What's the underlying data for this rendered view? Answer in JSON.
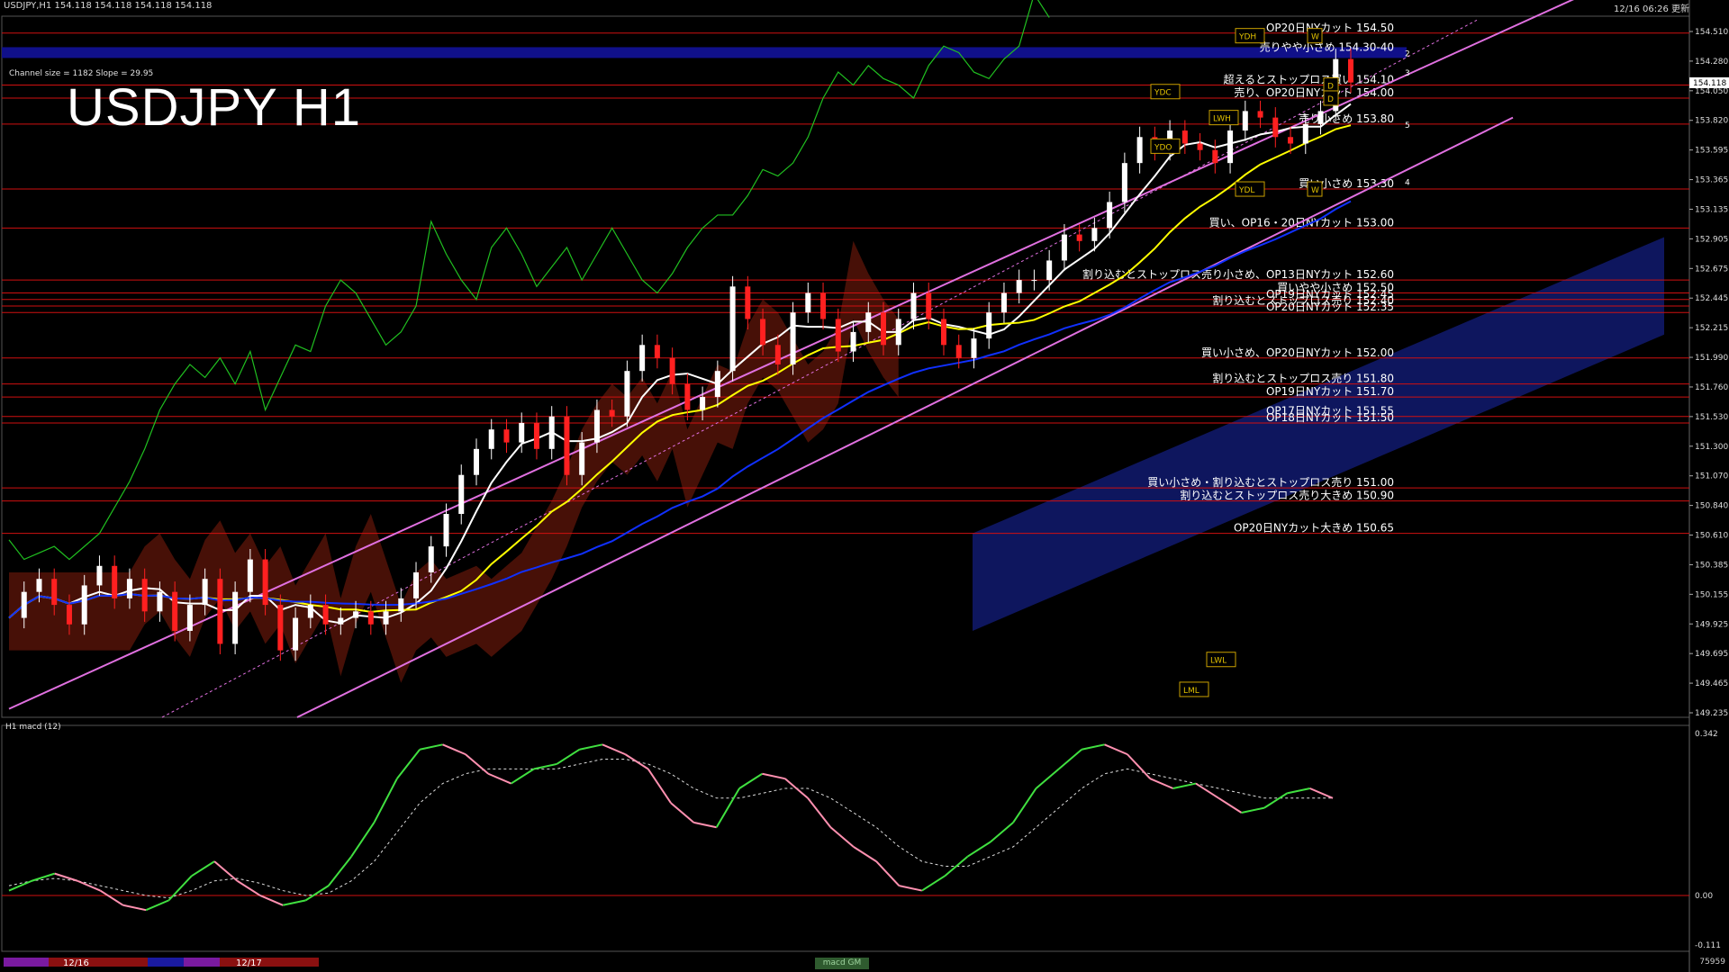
{
  "window": {
    "symbol_info": "USDJPY,H1  154.118 154.118 154.118 154.118",
    "updated": "12/16 06:26 更新",
    "chart_title": "USDJPY H1",
    "channel_info": "Channel size = 1182 Slope = 29.95",
    "sub_header": "H1  macd (12)",
    "macd_button": "macd GM",
    "corner_value": "75959"
  },
  "colors": {
    "background": "#000000",
    "candle_up": "#ffffff",
    "candle_down": "#ff2020",
    "level_line": "#d01010",
    "channel": "#e070e0",
    "cloud_red": "#ff3a1a",
    "cloud_blue": "#2030d0",
    "ma_fast": "#ffffff",
    "ma_mid": "#ffff00",
    "ma_slow": "#1030ff",
    "lagging": "#20c020",
    "macd_up": "#40e040",
    "macd_down": "#ff90b0"
  },
  "price_axis": {
    "labels": [
      "154.510",
      "154.280",
      "154.050",
      "153.820",
      "153.595",
      "153.365",
      "153.135",
      "152.905",
      "152.675",
      "152.445",
      "152.215",
      "151.990",
      "151.760",
      "151.530",
      "151.300",
      "151.070",
      "150.840",
      "150.610",
      "150.385",
      "150.155",
      "149.925",
      "149.695",
      "149.465",
      "149.235"
    ],
    "current_price": "154.118",
    "macd_labels": [
      "0.342",
      "0.00",
      "-0.111"
    ]
  },
  "date_labels": [
    "12/16",
    "12/17"
  ],
  "annotations": [
    {
      "text": "OP20日NYカット 154.50",
      "price": 154.5
    },
    {
      "text": "売りやや小さめ 154.30-40",
      "price": 154.35,
      "band": true
    },
    {
      "text": "超えるとストップロス買い 154.10",
      "price": 154.1
    },
    {
      "text": "売り、OP20日NYカット 154.00",
      "price": 154.0
    },
    {
      "text": "売り小さめ 153.80",
      "price": 153.8
    },
    {
      "text": "買い小さめ 153.30",
      "price": 153.3
    },
    {
      "text": "買い、OP16・20日NYカット 153.00",
      "price": 153.0
    },
    {
      "text": "割り込むとストップロス売り小さめ、OP13日NYカット 152.60",
      "price": 152.6
    },
    {
      "text": "買いやや小さめ 152.50",
      "price": 152.5
    },
    {
      "text": "OP19日NYカット 152.45",
      "price": 152.45
    },
    {
      "text": "割り込むとストップロス売り 152.40",
      "price": 152.4
    },
    {
      "text": "OP20日NYカット 152.35",
      "price": 152.35
    },
    {
      "text": "買い小さめ、OP20日NYカット 152.00",
      "price": 152.0
    },
    {
      "text": "割り込むとストップロス売り 151.80",
      "price": 151.8
    },
    {
      "text": "OP19日NYカット 151.70",
      "price": 151.7
    },
    {
      "text": "OP17日NYカット 151.55",
      "price": 151.55
    },
    {
      "text": "OP18日NYカット 151.50",
      "price": 151.5
    },
    {
      "text": "買い小さめ・割り込むとストップロス売り 151.00",
      "price": 151.0
    },
    {
      "text": "割り込むとストップロス売り大きめ 150.90",
      "price": 150.9
    },
    {
      "text": "OP20日NYカット大きめ 150.65",
      "price": 150.65
    }
  ],
  "markers": [
    {
      "label": "YDH",
      "price": 154.48
    },
    {
      "label": "YDC",
      "price": 154.05
    },
    {
      "label": "LWH",
      "price": 153.85
    },
    {
      "label": "YDO",
      "price": 153.63
    },
    {
      "label": "YDL",
      "price": 153.3
    },
    {
      "label": "LWL",
      "price": 149.68
    },
    {
      "label": "LML",
      "price": 149.45
    },
    {
      "label": "W",
      "price": 154.48
    },
    {
      "label": "D",
      "price": 154.1
    },
    {
      "label": "D",
      "price": 154.0
    },
    {
      "label": "W",
      "price": 153.3
    },
    {
      "label": "2",
      "price": 154.35
    },
    {
      "label": "3",
      "price": 154.2
    },
    {
      "label": "5",
      "price": 153.8
    },
    {
      "label": "4",
      "price": 153.36
    }
  ],
  "chart_data": {
    "type": "line",
    "title": "USDJPY H1",
    "xlabel": "",
    "ylabel": "",
    "ylim": [
      149.235,
      154.63
    ],
    "series": [
      {
        "values": [
          150.0,
          150.2,
          150.3,
          150.1,
          149.95,
          150.25,
          150.4,
          150.15,
          150.3,
          150.05,
          150.2,
          149.9,
          150.1,
          150.3,
          149.8,
          150.2,
          150.45,
          150.1,
          149.75,
          150.0,
          150.1,
          149.95,
          150.0,
          150.05,
          149.95,
          150.05,
          150.15,
          150.35,
          150.55,
          150.8,
          151.1,
          151.3,
          151.45,
          151.35,
          151.5,
          151.3,
          151.55,
          151.1,
          151.35,
          151.6,
          151.55,
          151.9,
          152.1,
          152.0,
          151.8,
          151.6,
          151.7,
          151.9,
          152.55,
          152.3,
          152.1,
          151.95,
          152.35,
          152.5,
          152.3,
          152.05,
          152.2,
          152.35,
          152.1,
          152.3,
          152.5,
          152.3,
          152.1,
          152.0,
          152.15,
          152.35,
          152.5,
          152.6,
          152.6,
          152.75,
          152.95,
          152.9,
          153.0,
          153.2,
          153.5,
          153.7,
          153.6,
          153.75,
          153.65,
          153.6,
          153.5,
          153.75,
          153.9,
          153.85,
          153.7,
          153.65,
          153.8,
          153.9,
          154.3,
          154.12
        ]
      }
    ]
  },
  "macd_data": {
    "type": "line",
    "ylim": [
      -0.111,
      0.342
    ],
    "main": [
      0.01,
      0.03,
      0.045,
      0.03,
      0.01,
      -0.02,
      -0.03,
      -0.01,
      0.04,
      0.07,
      0.03,
      0.0,
      -0.02,
      -0.01,
      0.02,
      0.08,
      0.15,
      0.24,
      0.3,
      0.31,
      0.29,
      0.25,
      0.23,
      0.26,
      0.27,
      0.3,
      0.31,
      0.29,
      0.26,
      0.19,
      0.15,
      0.14,
      0.22,
      0.25,
      0.24,
      0.2,
      0.14,
      0.1,
      0.07,
      0.02,
      0.01,
      0.04,
      0.08,
      0.11,
      0.15,
      0.22,
      0.26,
      0.3,
      0.31,
      0.29,
      0.24,
      0.22,
      0.23,
      0.2,
      0.17,
      0.18,
      0.21,
      0.22,
      0.2
    ],
    "signal": [
      0.02,
      0.03,
      0.035,
      0.03,
      0.02,
      0.01,
      0.0,
      -0.005,
      0.01,
      0.03,
      0.035,
      0.025,
      0.01,
      0.0,
      0.005,
      0.03,
      0.07,
      0.13,
      0.19,
      0.23,
      0.25,
      0.26,
      0.26,
      0.26,
      0.26,
      0.27,
      0.28,
      0.28,
      0.27,
      0.25,
      0.22,
      0.2,
      0.2,
      0.21,
      0.22,
      0.22,
      0.2,
      0.17,
      0.14,
      0.1,
      0.07,
      0.06,
      0.06,
      0.08,
      0.1,
      0.14,
      0.18,
      0.22,
      0.25,
      0.26,
      0.25,
      0.24,
      0.23,
      0.22,
      0.21,
      0.2,
      0.2,
      0.2,
      0.2
    ]
  }
}
